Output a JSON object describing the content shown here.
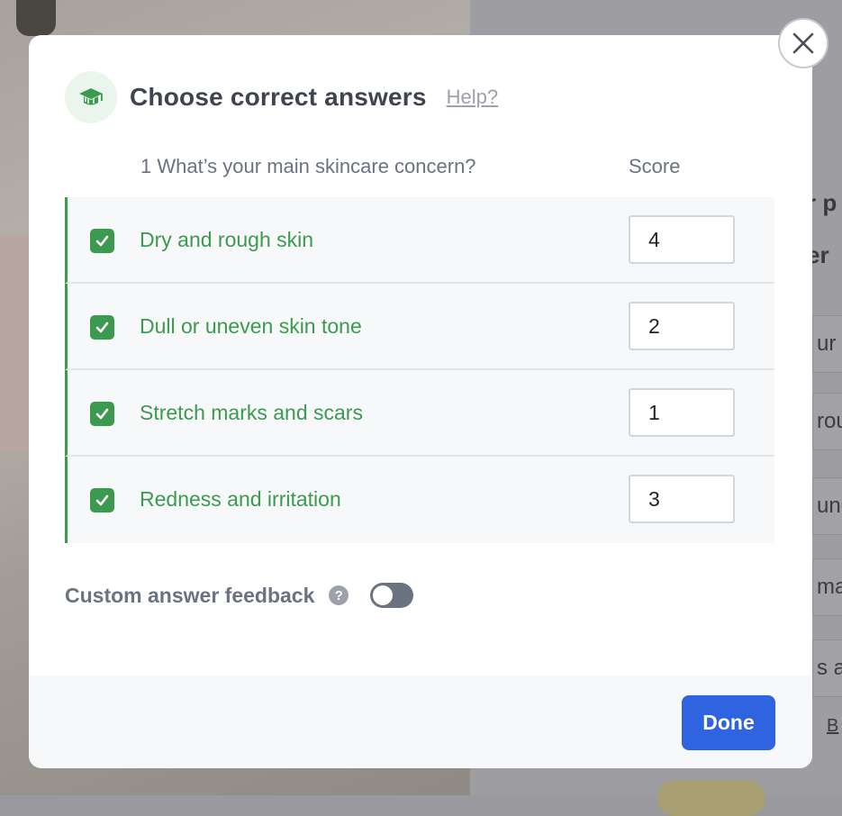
{
  "background": {
    "heading_fragment_1": "r p",
    "heading_fragment_2": "er",
    "option_fragments": [
      "ur",
      "rou",
      "une",
      "ma",
      "s a"
    ],
    "link_fragment": "B"
  },
  "modal": {
    "title": "Choose correct answers",
    "help_link": "Help?",
    "title_icon": "graduation-cap-icon",
    "close_icon": "close-icon",
    "accent_color": "#3c9a4e",
    "question": "1 What’s your main skincare concern?",
    "score_header": "Score",
    "answers": [
      {
        "label": "Dry and rough skin",
        "checked": true,
        "score": "4"
      },
      {
        "label": "Dull or uneven skin tone",
        "checked": true,
        "score": "2"
      },
      {
        "label": "Stretch marks and scars",
        "checked": true,
        "score": "1"
      },
      {
        "label": "Redness and irritation",
        "checked": true,
        "score": "3"
      }
    ],
    "feedback": {
      "label": "Custom answer feedback",
      "help_icon": "?",
      "toggle_on": false
    },
    "done_label": "Done",
    "done_color": "#2f63e0"
  }
}
